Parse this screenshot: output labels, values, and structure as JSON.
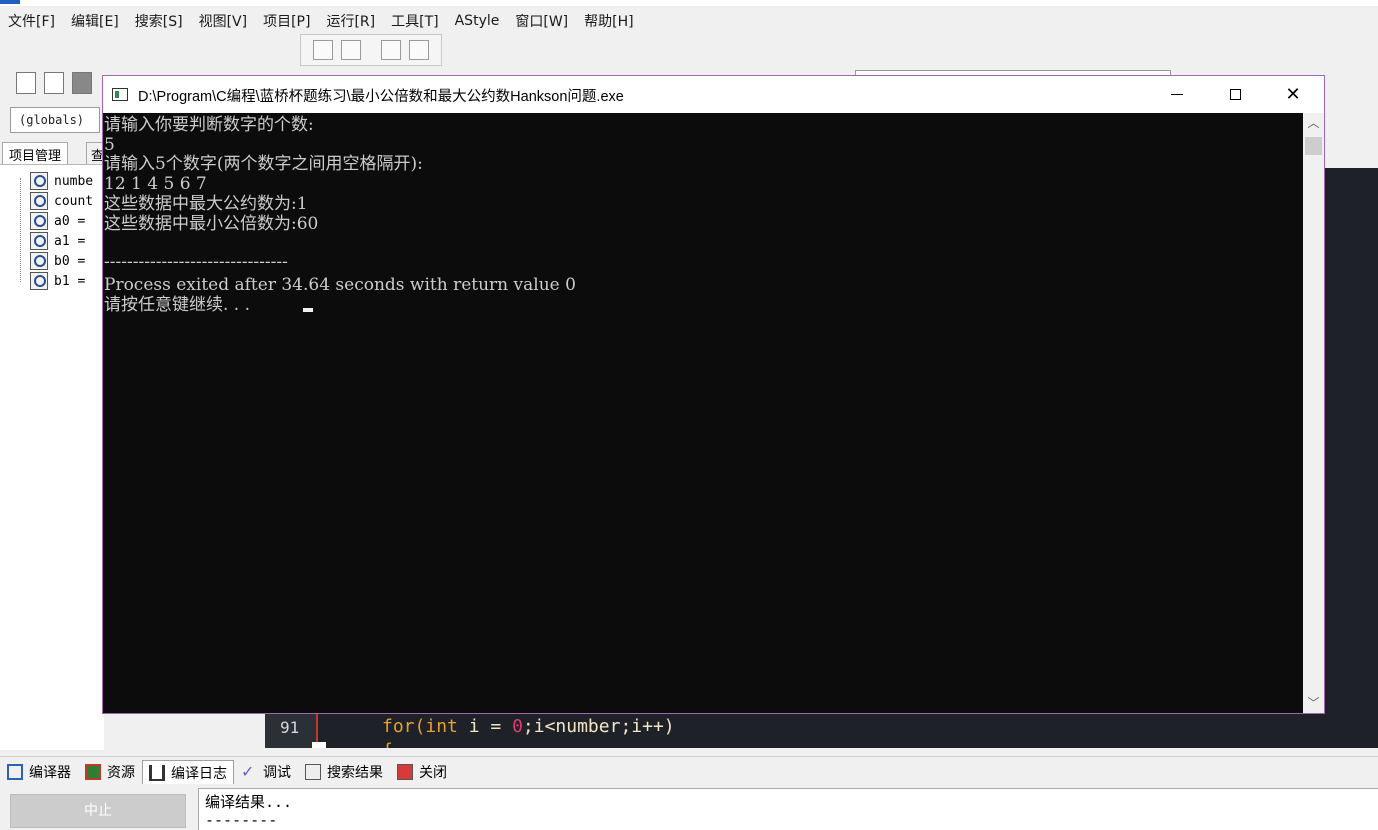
{
  "ide": {
    "menu": [
      "文件[F]",
      "编辑[E]",
      "搜索[S]",
      "视图[V]",
      "项目[P]",
      "运行[R]",
      "工具[T]",
      "AStyle",
      "窗口[W]",
      "帮助[H]"
    ],
    "globals_combo": "(globals)",
    "left_tabs": {
      "project": "项目管理",
      "class": "查"
    },
    "tree_items": [
      "numbe",
      "count",
      "a0 =",
      "a1 =",
      "b0 =",
      "b1 ="
    ],
    "editor": {
      "line_number": "91",
      "code": {
        "kw1": "for(",
        "kw2": "int",
        "mid": " i = ",
        "num": "0",
        "rest": ";i<number;i++)"
      },
      "next_line": "{"
    },
    "bottom_tabs": [
      "编译器",
      "资源",
      "编译日志",
      "调试",
      "搜索结果",
      "关闭"
    ],
    "stop_button": "中止",
    "log_lines": [
      "编译结果...",
      "--------"
    ]
  },
  "console": {
    "title": "D:\\Program\\C编程\\蓝桥杯题练习\\最小公倍数和最大公约数Hankson问题.exe",
    "lines": [
      "请输入你要判断数字的个数:",
      "5",
      "请输入5个数字(两个数字之间用空格隔开):",
      "12 1 4 5 6 7",
      "这些数据中最大公约数为:1",
      "这些数据中最小公倍数为:60",
      "",
      "--------------------------------",
      "Process exited after 34.64 seconds with return value 0",
      "请按任意键继续. . ."
    ]
  }
}
